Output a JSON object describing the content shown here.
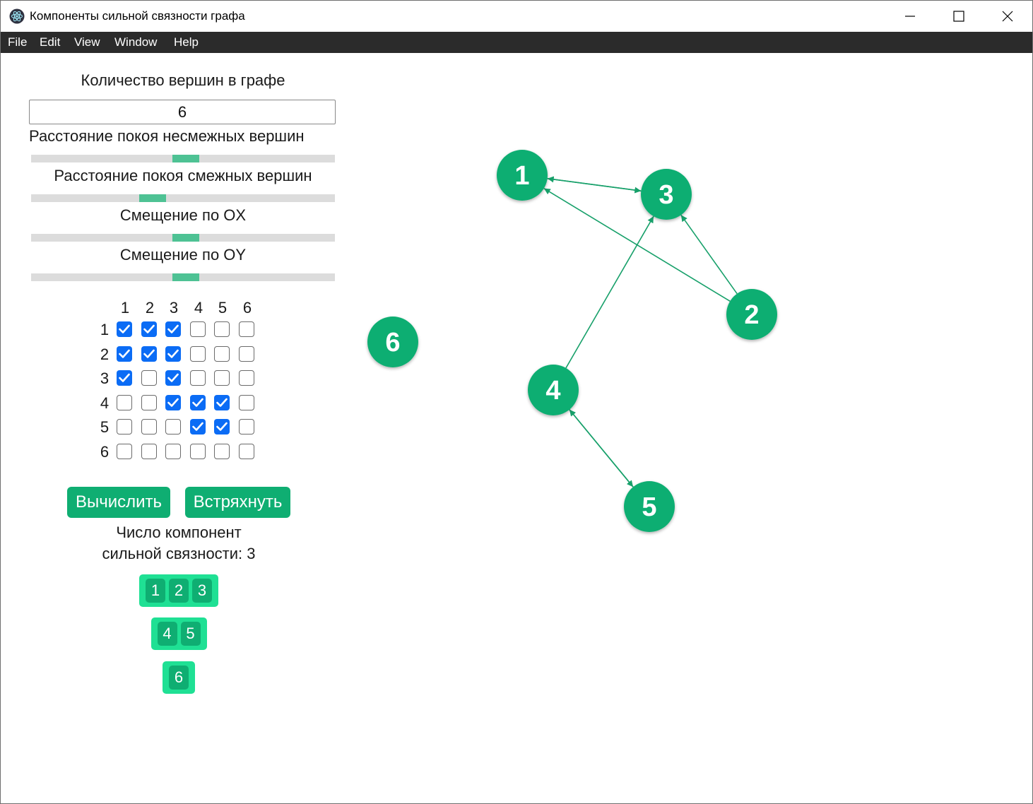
{
  "window": {
    "title": "Компоненты сильной связности графа"
  },
  "menu": [
    "File",
    "Edit",
    "View",
    "Window",
    "Help"
  ],
  "controls": {
    "vertex_count_label": "Количество вершин в графе",
    "vertex_count_value": "6",
    "sliders": [
      {
        "label": "Расстояние покоя несмежных вершин",
        "value": 0.5
      },
      {
        "label": "Расстояние покоя смежных вершин",
        "value": 0.38
      },
      {
        "label": "Смещение по OX",
        "value": 0.5
      },
      {
        "label": "Смещение по OY",
        "value": 0.5
      }
    ]
  },
  "matrix": {
    "headers": [
      "1",
      "2",
      "3",
      "4",
      "5",
      "6"
    ],
    "rows": [
      [
        true,
        true,
        true,
        false,
        false,
        false
      ],
      [
        true,
        true,
        true,
        false,
        false,
        false
      ],
      [
        true,
        false,
        true,
        false,
        false,
        false
      ],
      [
        false,
        false,
        true,
        true,
        true,
        false
      ],
      [
        false,
        false,
        false,
        true,
        true,
        false
      ],
      [
        false,
        false,
        false,
        false,
        false,
        false
      ]
    ]
  },
  "buttons": {
    "compute": "Вычислить",
    "shake": "Встряхнуть"
  },
  "result": {
    "line1": "Число компонент",
    "line2": "сильной связности: 3"
  },
  "components": [
    [
      "1",
      "2",
      "3"
    ],
    [
      "4",
      "5"
    ],
    [
      "6"
    ]
  ],
  "graph": {
    "nodes": [
      "1",
      "2",
      "3",
      "4",
      "5",
      "6"
    ],
    "edges": [
      [
        "1",
        "3"
      ],
      [
        "3",
        "1"
      ],
      [
        "2",
        "1"
      ],
      [
        "2",
        "3"
      ],
      [
        "4",
        "3"
      ],
      [
        "4",
        "5"
      ],
      [
        "5",
        "4"
      ]
    ],
    "node_color": "#0fae72",
    "edge_color": "#17a06a"
  },
  "colors": {
    "accent": "#0fae72",
    "component_bg": "#1fe094",
    "checkbox": "#0b6cf5",
    "slider_thumb": "#4ec294"
  }
}
